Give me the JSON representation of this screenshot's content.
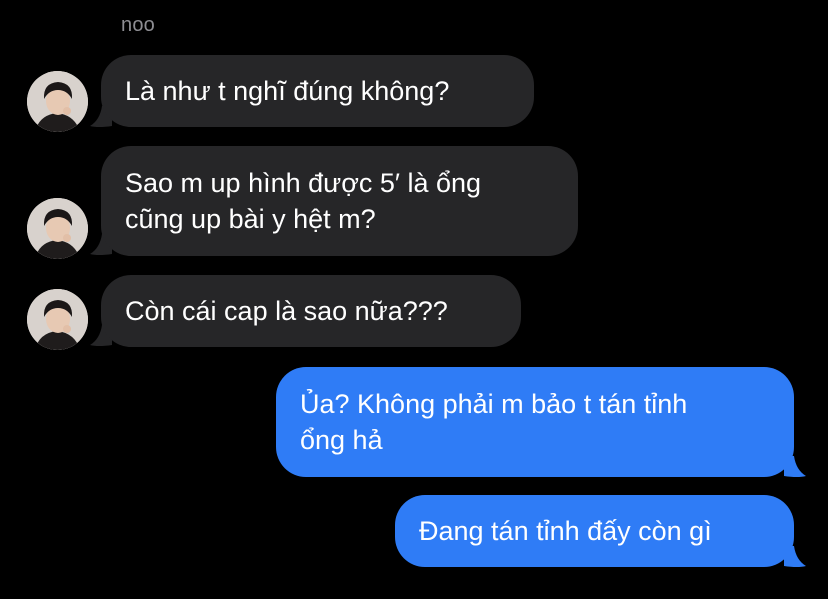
{
  "conversation": {
    "sender_name": "noo",
    "messages": [
      {
        "direction": "incoming",
        "text": "Là như t nghĩ đúng không?"
      },
      {
        "direction": "incoming",
        "text": "Sao m up hình được 5′ là ổng\ncũng up bài y hệt m?"
      },
      {
        "direction": "incoming",
        "text": "Còn cái cap là sao nữa???"
      },
      {
        "direction": "outgoing",
        "text": "Ủa? Không phải m bảo t tán tỉnh\nổng hả"
      },
      {
        "direction": "outgoing",
        "text": "Đang tán tỉnh đấy còn gì"
      }
    ]
  },
  "colors": {
    "background": "#000000",
    "incoming_bubble": "#262628",
    "outgoing_bubble": "#2f7cf6",
    "sender_name": "#8e8e93"
  },
  "icons": {
    "avatar": "contact-photo"
  }
}
